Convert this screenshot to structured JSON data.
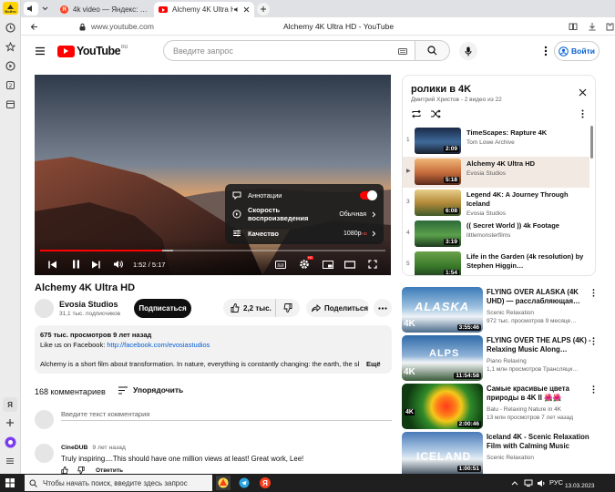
{
  "sidebar": {
    "logo_label": "Войти",
    "bottom_label": "Я"
  },
  "tabs": [
    {
      "title": "4k video — Яндекс: нашл"
    },
    {
      "title": "Alchemy 4K Ultra HD"
    }
  ],
  "address": {
    "url": "www.youtube.com",
    "page_title": "Alchemy 4K Ultra HD - YouTube"
  },
  "youtube": {
    "logo_text": "YouTube",
    "region": "RU",
    "search_placeholder": "Введите запрос",
    "signin_label": "Войти"
  },
  "player": {
    "time_current": "1:52",
    "time_total": "5:17",
    "progress": 0.354,
    "settings": [
      {
        "label": "Аннотации",
        "value": ""
      },
      {
        "label": "Скорость воспроизведения",
        "value": "Обычная"
      },
      {
        "label": "Качество",
        "value": "1080p",
        "badge": "HD"
      }
    ]
  },
  "video": {
    "title": "Alchemy 4K Ultra HD",
    "channel": "Evosia Studios",
    "subscribers": "31,1 тыс. подписчиков",
    "subscribe_label": "Подписаться",
    "likes": "2,2 тыс.",
    "share_label": "Поделиться",
    "views_date": "675 тыс. просмотров  9 лет назад",
    "desc_line1_prefix": "Like us on Facebook: ",
    "desc_link": "http://facebook.com/evosiastudios",
    "desc_line2": "Alchemy is a short film about transformation. In nature, everything is constantly changing: the earth, the sky,",
    "more_label": "Ещё"
  },
  "comments": {
    "count_label": "168 комментариев",
    "sort_label": "Упорядочить",
    "input_placeholder": "Введите текст комментария",
    "items": [
      {
        "author": "CineDUB",
        "age": "9 лет назад",
        "text": "Truly inspiring....This should have one million views at least! Great work, Lee!",
        "reply": "Ответить"
      }
    ]
  },
  "playlist": {
    "title": "ролики в 4K",
    "meta": "Дмитрий Христов - 2 видео из 22",
    "items": [
      {
        "index": "1",
        "title": "TimeScapes: Rapture 4K",
        "author": "Tom Lowe Archive",
        "duration": "2:09"
      },
      {
        "index": "▶",
        "title": "Alchemy 4K Ultra HD",
        "author": "Evosia Studios",
        "duration": "5:18"
      },
      {
        "index": "3",
        "title": "Legend 4K: A Journey Through Iceland",
        "author": "Evosia Studios",
        "duration": "6:08"
      },
      {
        "index": "4",
        "title": "(( Secret World )) 4k Footage",
        "author": "littlemonsterfilms",
        "duration": "3:19"
      },
      {
        "index": "5",
        "title": "Life in the Garden (4k resolution) by Stephen Higgin…",
        "author": "",
        "duration": "1:54"
      }
    ]
  },
  "related": [
    {
      "title": "FLYING OVER ALASKA (4K UHD) — расслабляющая…",
      "channel": "Scenic Relaxation",
      "stats": "972 тыс. просмотров  9 месяце…",
      "duration": "3:55:46",
      "overlay": "ALASKA",
      "badge": "4K"
    },
    {
      "title": "FLYING OVER THE ALPS (4K) - Relaxing Music Along…",
      "channel": "Piano Relaxing",
      "stats": "1,1 млн просмотров  Трансляци…",
      "duration": "11:54:58",
      "overlay": "ALPS",
      "badge": "4K"
    },
    {
      "title": "Самые красивые цвета природы в 4K II 🌺🌺",
      "channel": "Balu - Relaxing Nature in 4K",
      "stats": "13 млн просмотров  7 лет назад",
      "duration": "2:00:46",
      "overlay": "",
      "badge": "4K"
    },
    {
      "title": "Iceland 4K - Scenic Relaxation Film with Calming Music",
      "channel": "Scenic Relaxation",
      "stats": "",
      "duration": "1:00:51",
      "overlay": "ICELAND",
      "badge": "4K"
    }
  ],
  "taskbar": {
    "search_placeholder": "Чтобы начать поиск, введите здесь запрос",
    "lang": "РУС",
    "date": "13.03.2023",
    "yandex_letter": "Я"
  },
  "colors": {
    "youtube_red": "#ff0000",
    "link_blue": "#065fd4",
    "subscribe_bg": "#0f0f0f",
    "active_row": "#f2e9e2"
  }
}
